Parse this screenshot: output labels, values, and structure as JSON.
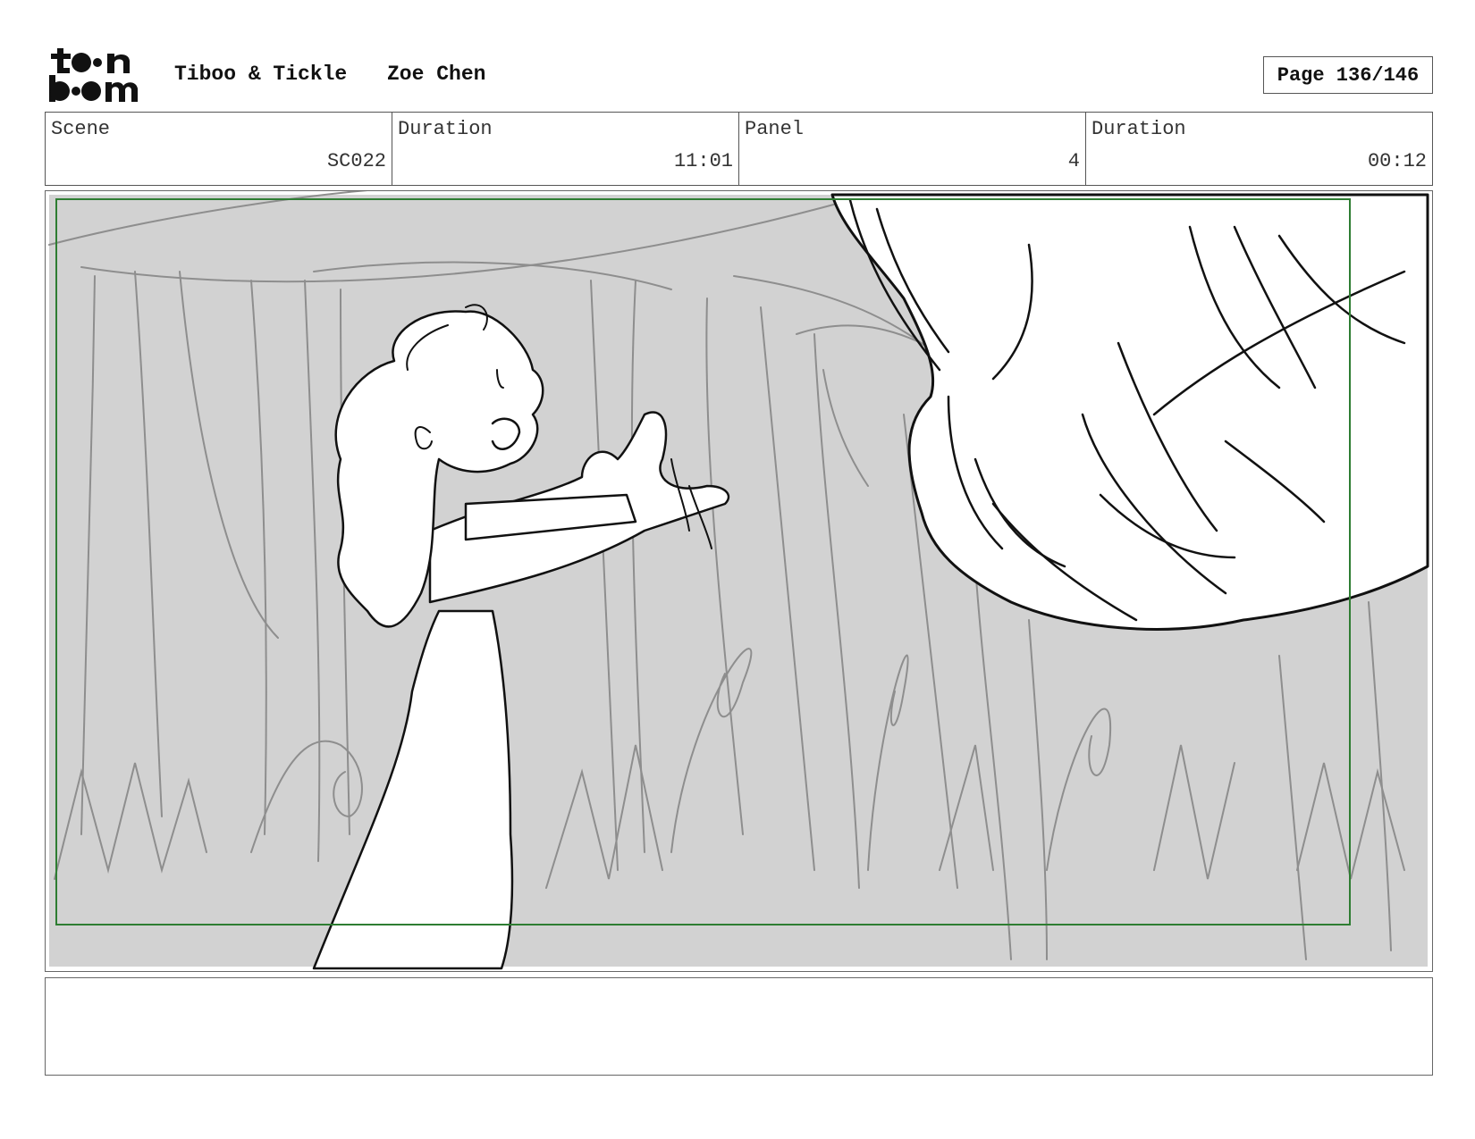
{
  "header": {
    "logo_text": "toon boom",
    "project_title": "Tiboo & Tickle",
    "artist": "Zoe Chen",
    "page": "Page 136/146"
  },
  "info": [
    {
      "label": "Scene",
      "value": "SC022"
    },
    {
      "label": "Duration",
      "value": "11:01"
    },
    {
      "label": "Panel",
      "value": "4"
    },
    {
      "label": "Duration",
      "value": "00:12"
    }
  ],
  "panel": {
    "image": "storyboard-sketch-forest-girl-reaching",
    "colors": {
      "background": "#d2d2d2",
      "safe_frame": "#2e7d32",
      "ink": "#111111",
      "sketch": "#8e8e8e"
    }
  },
  "notes": {
    "text": ""
  }
}
